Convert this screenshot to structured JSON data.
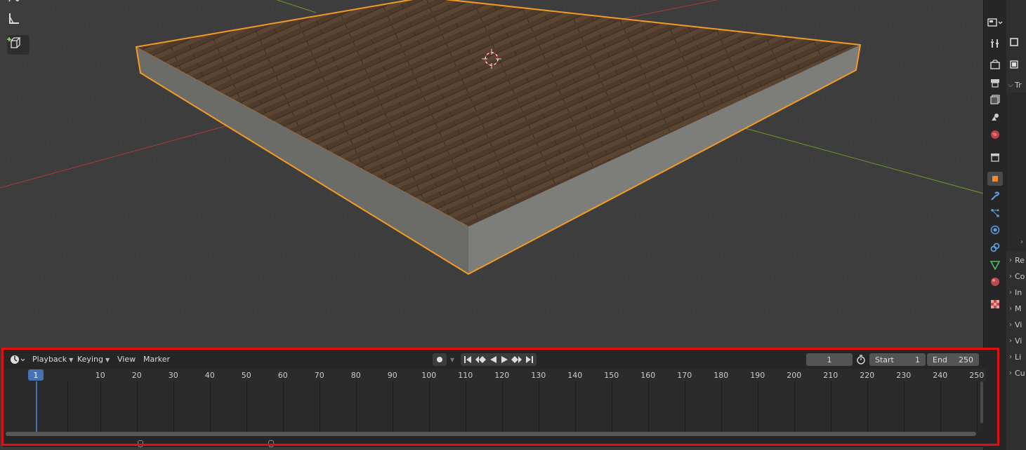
{
  "timeline": {
    "menus": [
      {
        "label": "Playback",
        "has_dropdown": true
      },
      {
        "label": "Keying",
        "has_dropdown": true
      },
      {
        "label": "View",
        "has_dropdown": false
      },
      {
        "label": "Marker",
        "has_dropdown": false
      }
    ],
    "current_frame": "1",
    "start_label": "Start",
    "start_value": "1",
    "end_label": "End",
    "end_value": "250",
    "ruler_ticks": [
      "10",
      "20",
      "30",
      "40",
      "50",
      "60",
      "70",
      "80",
      "90",
      "100",
      "110",
      "120",
      "130",
      "140",
      "150",
      "160",
      "170",
      "180",
      "190",
      "200",
      "210",
      "220",
      "230",
      "240",
      "250"
    ],
    "current_frame_marker": "1"
  },
  "properties_panel": {
    "sections": [
      "Tr",
      "Re",
      "Co",
      "In",
      "M",
      "Vi",
      "Vi",
      "Li",
      "Cu"
    ]
  },
  "colors": {
    "selection_outline": "#f59a23",
    "timeline_highlight": "#e01010",
    "frame_accent": "#4772b3"
  }
}
